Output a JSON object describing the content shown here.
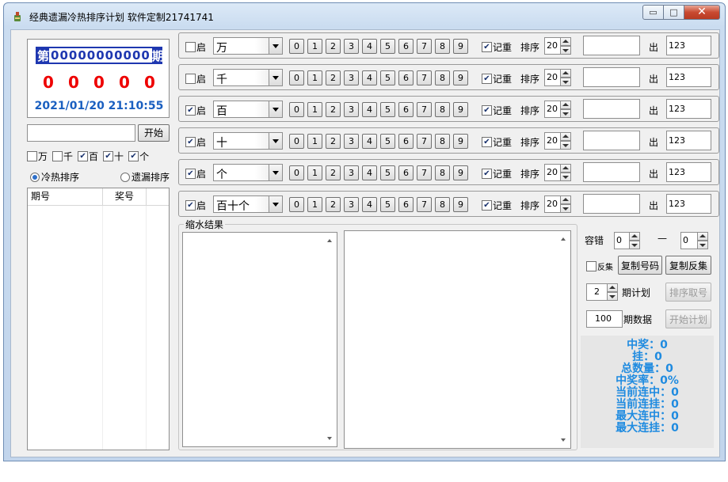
{
  "window": {
    "title": "经典遗漏冷热排序计划 软件定制21741741",
    "min_symbol": "▭",
    "max_symbol": "□",
    "close_symbol": "✕"
  },
  "issue": {
    "prefix": "第",
    "number": "00000000000",
    "suffix": "期",
    "digits": [
      "0",
      "0",
      "0",
      "0",
      "0"
    ],
    "datetime": "2021/01/20  21:10:55"
  },
  "search": {
    "value": ""
  },
  "start_label": "开始",
  "positions": [
    {
      "label": "万",
      "checked": false
    },
    {
      "label": "千",
      "checked": false
    },
    {
      "label": "百",
      "checked": true
    },
    {
      "label": "十",
      "checked": true
    },
    {
      "label": "个",
      "checked": true
    }
  ],
  "sort_modes": [
    {
      "label": "冷热排序",
      "selected": true
    },
    {
      "label": "遗漏排序",
      "selected": false
    }
  ],
  "history": {
    "col1": "期号",
    "col2": "奖号"
  },
  "rows": [
    {
      "enable_label": "启",
      "enabled": false,
      "position": "万",
      "digits": [
        "0",
        "1",
        "2",
        "3",
        "4",
        "5",
        "6",
        "7",
        "8",
        "9"
      ],
      "mem_label": "记重",
      "mem": true,
      "sort_label": "排序",
      "sort_value": "20",
      "out_label": "出",
      "out_value": "123"
    },
    {
      "enable_label": "启",
      "enabled": false,
      "position": "千",
      "digits": [
        "0",
        "1",
        "2",
        "3",
        "4",
        "5",
        "6",
        "7",
        "8",
        "9"
      ],
      "mem_label": "记重",
      "mem": true,
      "sort_label": "排序",
      "sort_value": "20",
      "out_label": "出",
      "out_value": "123"
    },
    {
      "enable_label": "启",
      "enabled": true,
      "position": "百",
      "digits": [
        "0",
        "1",
        "2",
        "3",
        "4",
        "5",
        "6",
        "7",
        "8",
        "9"
      ],
      "mem_label": "记重",
      "mem": true,
      "sort_label": "排序",
      "sort_value": "20",
      "out_label": "出",
      "out_value": "123"
    },
    {
      "enable_label": "启",
      "enabled": true,
      "position": "十",
      "digits": [
        "0",
        "1",
        "2",
        "3",
        "4",
        "5",
        "6",
        "7",
        "8",
        "9"
      ],
      "mem_label": "记重",
      "mem": true,
      "sort_label": "排序",
      "sort_value": "20",
      "out_label": "出",
      "out_value": "123"
    },
    {
      "enable_label": "启",
      "enabled": true,
      "position": "个",
      "digits": [
        "0",
        "1",
        "2",
        "3",
        "4",
        "5",
        "6",
        "7",
        "8",
        "9"
      ],
      "mem_label": "记重",
      "mem": true,
      "sort_label": "排序",
      "sort_value": "20",
      "out_label": "出",
      "out_value": "123"
    },
    {
      "enable_label": "启",
      "enabled": true,
      "position": "百十个",
      "digits": [
        "0",
        "1",
        "2",
        "3",
        "4",
        "5",
        "6",
        "7",
        "8",
        "9"
      ],
      "mem_label": "记重",
      "mem": true,
      "sort_label": "排序",
      "sort_value": "20",
      "out_label": "出",
      "out_value": "123"
    }
  ],
  "results": {
    "legend": "缩水结果"
  },
  "side": {
    "tolerance_label": "容错",
    "tol_from": "0",
    "tol_dash": "—",
    "tol_to": "0",
    "reverse_label": "反集",
    "reverse_checked": false,
    "copy_code": "复制号码",
    "copy_reverse": "复制反集",
    "plan_value": "2",
    "plan_label": "期计划",
    "sort_take": "排序取号",
    "data_value": "100",
    "data_label": "期数据",
    "start_plan": "开始计划"
  },
  "stats": [
    "中奖：0",
    "挂：0",
    "总数量：0",
    "中奖率：0%",
    "当前连中：0",
    "当前连挂：0",
    "最大连中：0",
    "最大连挂：0"
  ]
}
